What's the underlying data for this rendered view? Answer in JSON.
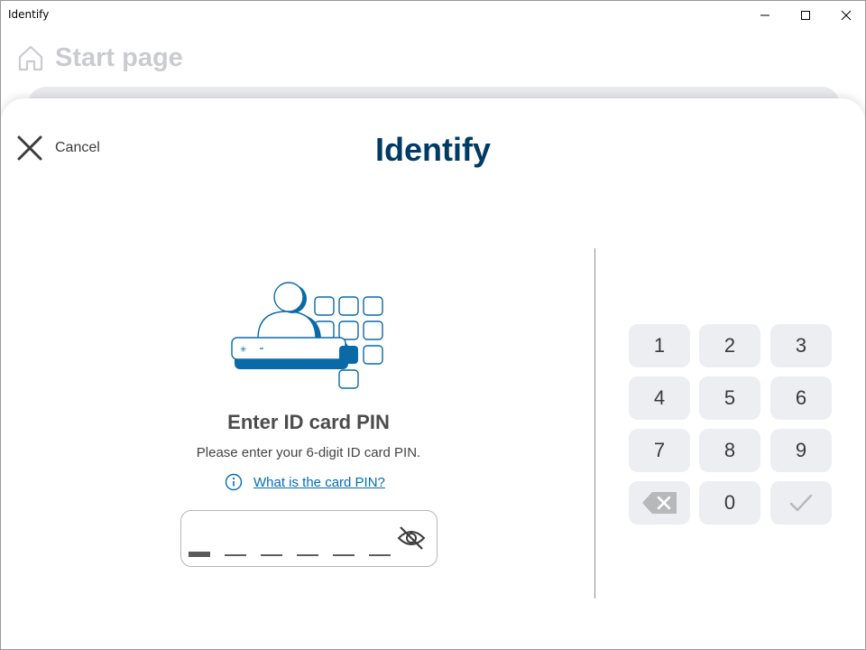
{
  "window": {
    "title": "Identify"
  },
  "background_page": {
    "title": "Start page",
    "icon": "home-icon"
  },
  "dialog": {
    "title": "Identify",
    "cancel_label": "Cancel",
    "cancel_icon": "close-icon",
    "illustration": "id-card-pin-illustration",
    "heading": "Enter ID card PIN",
    "subtext": "Please enter your 6-digit ID card PIN.",
    "help_link": "What is the card PIN?",
    "help_icon": "info-icon"
  },
  "pin_input": {
    "length": 6,
    "entered": 0,
    "visibility_icon": "eye-off-icon"
  },
  "keypad": {
    "keys": [
      "1",
      "2",
      "3",
      "4",
      "5",
      "6",
      "7",
      "8",
      "9",
      "",
      "0",
      ""
    ],
    "backspace_icon": "backspace-icon",
    "confirm_icon": "checkmark-icon",
    "confirm_enabled": false
  },
  "colors": {
    "accent": "#006eb5",
    "title": "#003b63",
    "key_background": "#eceef1"
  }
}
